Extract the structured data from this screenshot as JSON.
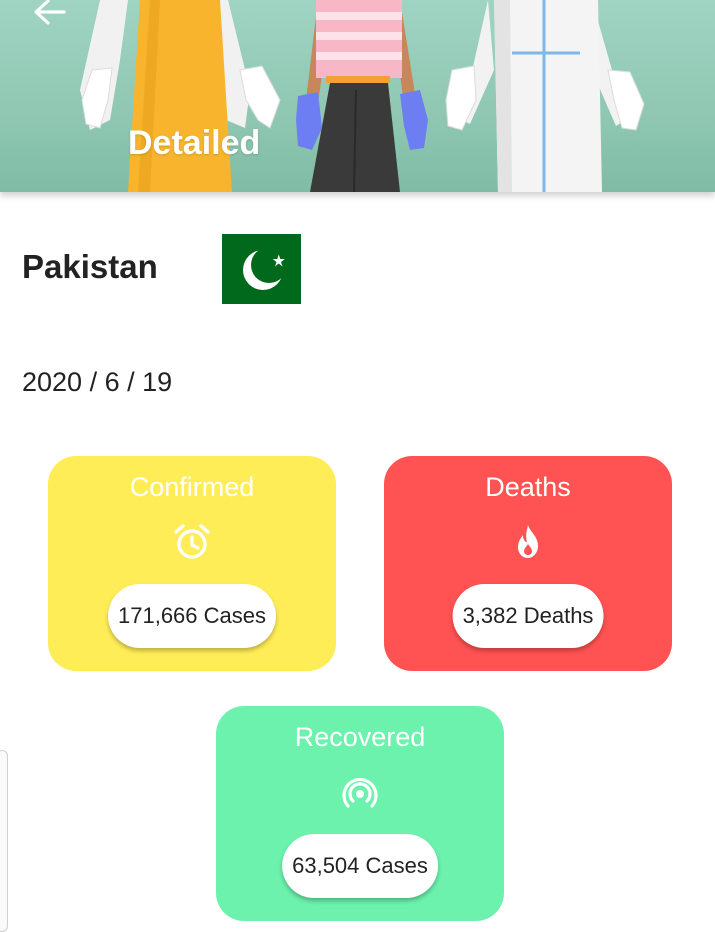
{
  "header": {
    "title": "Detailed",
    "back_icon": "arrow-left-icon",
    "background": "#8fc7b3"
  },
  "country": {
    "name": "Pakistan",
    "flag_icon": "pakistan-flag-icon"
  },
  "date": "2020 / 6 / 19",
  "cards": {
    "confirmed": {
      "title": "Confirmed",
      "value": "171,666 Cases",
      "icon": "alarm-clock-icon",
      "color": "#ffed57"
    },
    "deaths": {
      "title": "Deaths",
      "value": "3,382 Deaths",
      "icon": "flame-icon",
      "color": "#ff5252"
    },
    "recovered": {
      "title": "Recovered",
      "value": "63,504 Cases",
      "icon": "signal-broadcast-icon",
      "color": "#6cf2ad"
    }
  }
}
